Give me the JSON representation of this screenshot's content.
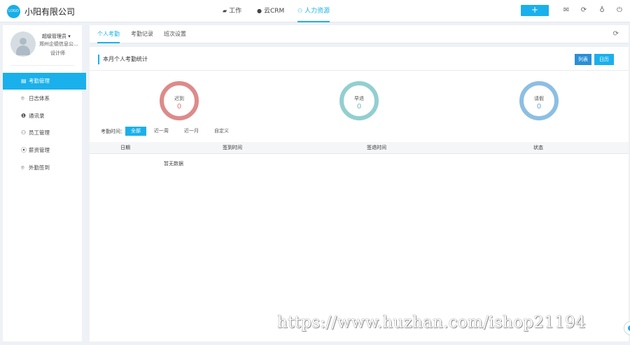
{
  "header": {
    "logo_text": "LOGO",
    "company_name": "小阳有限公司",
    "nav": [
      {
        "icon": "briefcase-icon",
        "glyph": "▰",
        "label": "工作"
      },
      {
        "icon": "cloud-icon",
        "glyph": "●",
        "label": "云CRM"
      },
      {
        "icon": "people-icon",
        "glyph": "⚇",
        "label": "人力资源"
      }
    ],
    "add_button": "+",
    "icons": {
      "mail": "✉",
      "sync": "⟳",
      "bulb": "♁",
      "power": "⏻"
    }
  },
  "sidebar": {
    "user_role": "超级管理员 ▾",
    "user_org": "郑州企德信息公...",
    "user_title": "设计师",
    "items": [
      {
        "icon": "attendance-icon",
        "glyph": "▤",
        "label": "考勤管理"
      },
      {
        "icon": "location-icon",
        "glyph": "⌾",
        "label": "日志体系"
      },
      {
        "icon": "contacts-icon",
        "glyph": "❶",
        "label": "通讯录"
      },
      {
        "icon": "staff-icon",
        "glyph": "⚇",
        "label": "员工管理"
      },
      {
        "icon": "salary-icon",
        "glyph": "⦿",
        "label": "薪资管理"
      },
      {
        "icon": "checkin-icon",
        "glyph": "⌾",
        "label": "外勤签到"
      }
    ]
  },
  "main": {
    "tabs": [
      "个人考勤",
      "考勤记录",
      "班次设置"
    ],
    "refresh_glyph": "⟳",
    "section_title": "本月个人考勤统计",
    "view_buttons": {
      "list": "列表",
      "calendar": "日历"
    },
    "stats": [
      {
        "label": "迟到",
        "value": "0"
      },
      {
        "label": "早退",
        "value": "0"
      },
      {
        "label": "请假",
        "value": "0"
      }
    ],
    "filter_label": "考勤时间：",
    "filter_options": [
      "全部",
      "近一周",
      "近一月",
      "自定义"
    ],
    "table_columns": [
      "日期",
      "签到时间",
      "签退时间",
      "状态"
    ],
    "empty_text": "暂无数据"
  },
  "watermark": "https://www.huzhan.com/ishop21194",
  "colors": {
    "accent": "#1ab0ec",
    "late": "#de8a8a",
    "early": "#93cfd0",
    "leave": "#8dbfe3"
  }
}
